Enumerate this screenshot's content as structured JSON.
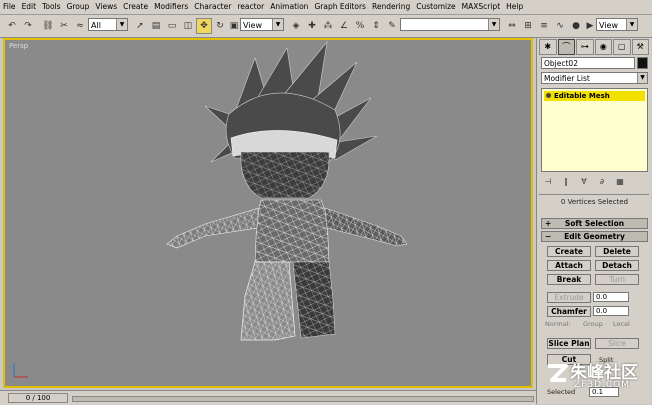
{
  "menu": [
    "File",
    "Edit",
    "Tools",
    "Group",
    "Views",
    "Create",
    "Modifiers",
    "Character",
    "reactor",
    "Animation",
    "Graph Editors",
    "Rendering",
    "Customize",
    "MAXScript",
    "Help"
  ],
  "toolbar": {
    "selection_filter": "All",
    "ref_coord": "View",
    "named_selection": "",
    "right_view": "View"
  },
  "viewport": {
    "label": "Persp"
  },
  "command_panel": {
    "object_name": "Object02",
    "modifier_list": "Modifier List",
    "stack_item": "Editable Mesh",
    "selection_count": "0 Vertices Selected",
    "rollouts": {
      "soft_selection": "Soft Selection",
      "edit_geometry": "Edit Geometry"
    },
    "buttons": {
      "create": "Create",
      "delete": "Delete",
      "attach": "Attach",
      "detach": "Detach",
      "break": "Break",
      "turn": "Turn",
      "extrude": "Extrude",
      "chamfer": "Chamfer",
      "slice_plane": "Slice Plan",
      "slice": "Slice",
      "cut": "Cut",
      "split": "Split"
    },
    "extrude_value": "0.0",
    "chamfer_value": "0.0",
    "normal_label": "Normal:",
    "group_label": "Group",
    "local_label": "Local",
    "selected_label": "Selected",
    "selected_value": "0.1"
  },
  "status": {
    "time_slider": "0 / 100"
  },
  "watermark": {
    "cn": "朱峰社区",
    "url": "ZF3D.COM"
  }
}
